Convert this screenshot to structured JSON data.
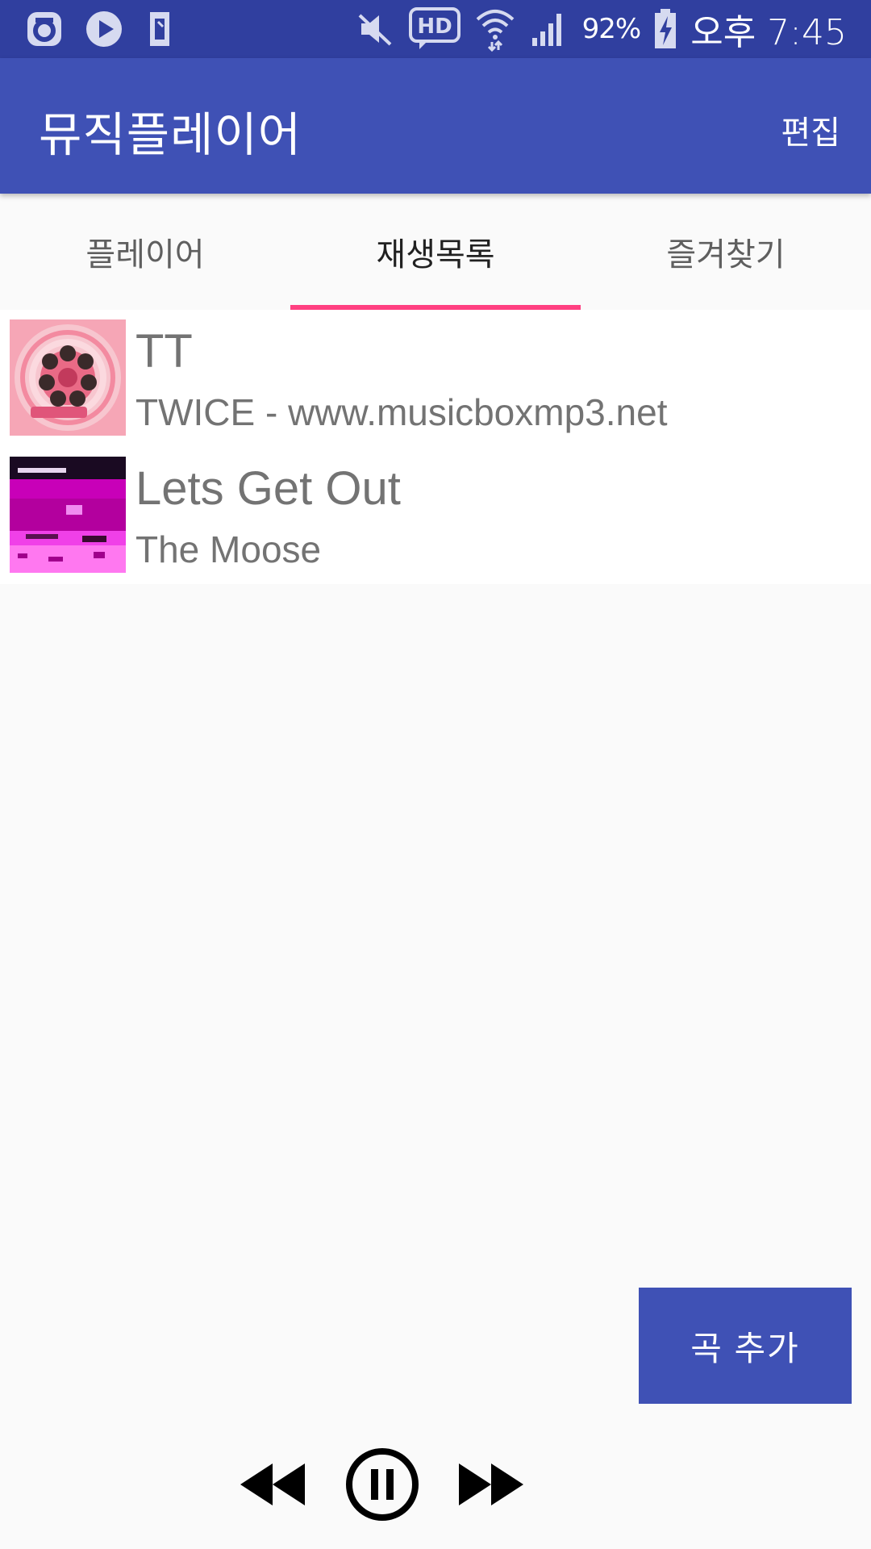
{
  "status_bar": {
    "battery_percent": "92%",
    "time": "오후 7:45",
    "icons": [
      "sync-icon",
      "play-store-icon",
      "sd-card-icon",
      "mute-icon",
      "hd-voice-icon",
      "wifi-icon",
      "signal-icon",
      "battery-charging-icon"
    ]
  },
  "app_bar": {
    "title": "뮤직플레이어",
    "edit_label": "편집"
  },
  "tabs": [
    {
      "label": "플레이어",
      "active": false
    },
    {
      "label": "재생목록",
      "active": true
    },
    {
      "label": "즐겨찾기",
      "active": false
    }
  ],
  "playlist": [
    {
      "title": "TT",
      "subtitle": "TWICE - www.musicboxmp3.net",
      "art_icon": "album-art-icon"
    },
    {
      "title": "Lets Get Out",
      "subtitle": "The Moose",
      "art_icon": "album-art-icon"
    }
  ],
  "add_button": {
    "label": "곡 추가"
  },
  "controls": {
    "icons": [
      "rewind-icon",
      "pause-icon",
      "fast-forward-icon"
    ]
  },
  "colors": {
    "status_bar": "#303f9f",
    "primary": "#3f51b5",
    "accent": "#ff4081",
    "background": "#fafafa",
    "track_text": "#737373"
  }
}
